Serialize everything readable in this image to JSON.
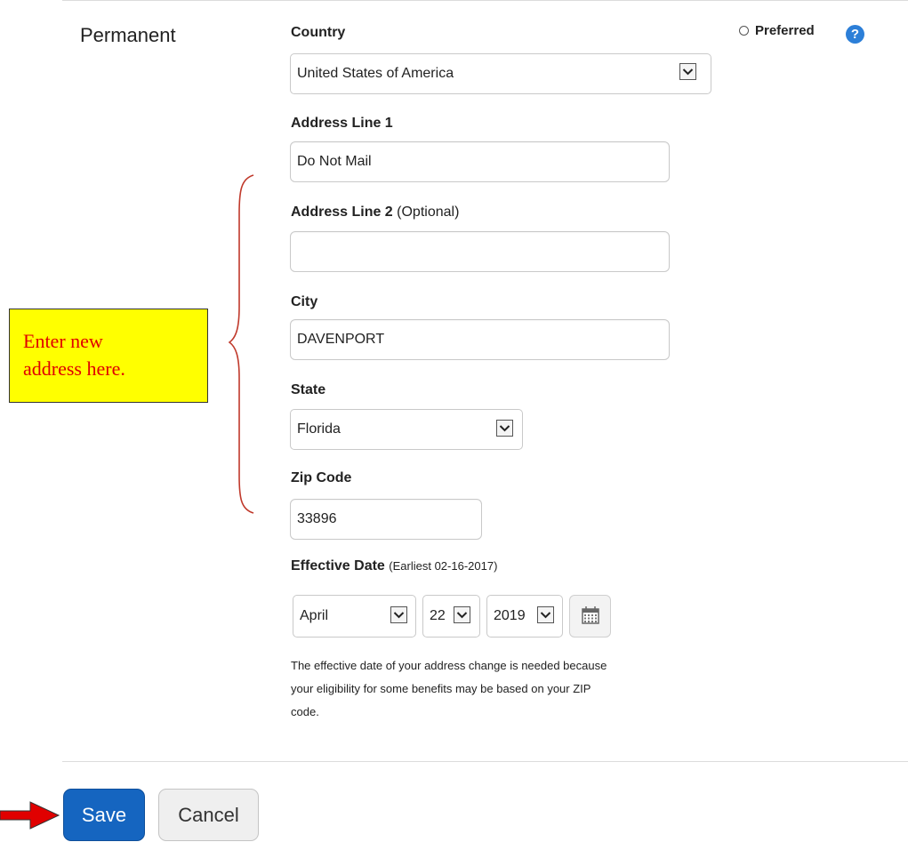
{
  "section": {
    "label": "Permanent"
  },
  "preferred": {
    "label": "Preferred",
    "help_icon": "?"
  },
  "country": {
    "label": "Country",
    "value": "United States of America"
  },
  "address1": {
    "label": "Address Line 1",
    "value": "Do Not Mail"
  },
  "address2": {
    "label": "Address Line 2",
    "optional": "(Optional)",
    "value": ""
  },
  "city": {
    "label": "City",
    "value": "DAVENPORT"
  },
  "state": {
    "label": "State",
    "value": "Florida"
  },
  "zip": {
    "label": "Zip Code",
    "value": "33896"
  },
  "effective_date": {
    "label": "Effective Date",
    "earliest": "(Earliest 02-16-2017)",
    "month": "April",
    "day": "22",
    "year": "2019",
    "calendar_icon": "calendar-icon"
  },
  "note": {
    "line1": "The effective date of your address change is needed because",
    "line2": "your eligibility for some benefits may be based on your ZIP",
    "line3": "code."
  },
  "annotation": {
    "line1": "Enter new",
    "line2": "address here.",
    "colors": {
      "box": "#ffff00",
      "text": "#e00000",
      "brace": "#c0392b",
      "arrow": "#e00000"
    }
  },
  "actions": {
    "save": "Save",
    "cancel": "Cancel"
  },
  "colors": {
    "primary": "#1565c0",
    "help": "#2c7fd8"
  }
}
